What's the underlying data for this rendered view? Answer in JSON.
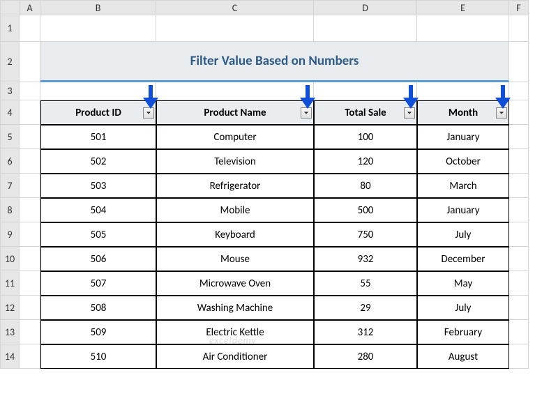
{
  "columns": [
    "A",
    "B",
    "C",
    "D",
    "E",
    "F"
  ],
  "rows": [
    "1",
    "2",
    "3",
    "4",
    "5",
    "6",
    "7",
    "8",
    "9",
    "10",
    "11",
    "12",
    "13",
    "14"
  ],
  "title": "Filter Value Based on Numbers",
  "headers": {
    "product_id": "Product ID",
    "product_name": "Product Name",
    "total_sale": "Total Sale",
    "month": "Month"
  },
  "chart_data": {
    "type": "table",
    "title": "Filter Value Based on Numbers",
    "columns": [
      "Product ID",
      "Product Name",
      "Total Sale",
      "Month"
    ],
    "rows": [
      {
        "product_id": "501",
        "product_name": "Computer",
        "total_sale": "100",
        "month": "January"
      },
      {
        "product_id": "502",
        "product_name": "Television",
        "total_sale": "120",
        "month": "October"
      },
      {
        "product_id": "503",
        "product_name": "Refrigerator",
        "total_sale": "80",
        "month": "March"
      },
      {
        "product_id": "504",
        "product_name": "Mobile",
        "total_sale": "500",
        "month": "January"
      },
      {
        "product_id": "505",
        "product_name": "Keyboard",
        "total_sale": "750",
        "month": "July"
      },
      {
        "product_id": "506",
        "product_name": "Mouse",
        "total_sale": "932",
        "month": "December"
      },
      {
        "product_id": "507",
        "product_name": "Microwave Oven",
        "total_sale": "55",
        "month": "May"
      },
      {
        "product_id": "508",
        "product_name": "Washing Machine",
        "total_sale": "29",
        "month": "July"
      },
      {
        "product_id": "509",
        "product_name": "Electric Kettle",
        "total_sale": "312",
        "month": "February"
      },
      {
        "product_id": "510",
        "product_name": "Air Conditioner",
        "total_sale": "280",
        "month": "August"
      }
    ]
  },
  "watermark": "exceldemy"
}
